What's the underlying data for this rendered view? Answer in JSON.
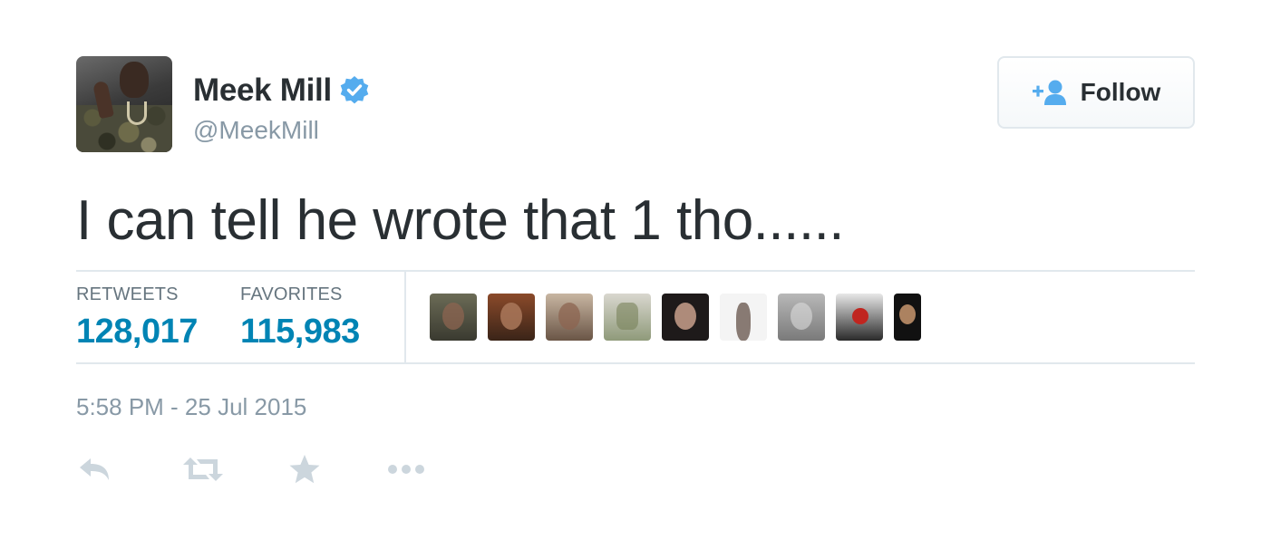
{
  "user": {
    "display_name": "Meek Mill",
    "handle": "@MeekMill",
    "verified": true,
    "verified_icon": "verified-badge-icon"
  },
  "follow_button": {
    "label": "Follow",
    "icon": "add-user-icon"
  },
  "tweet": {
    "text": "I can tell he wrote that 1 tho......",
    "timestamp": "5:58 PM - 25 Jul 2015"
  },
  "stats": {
    "retweets_label": "RETWEETS",
    "retweets_value": "128,017",
    "favorites_label": "FAVORITES",
    "favorites_value": "115,983"
  },
  "favoriters": [
    "face-1",
    "face-2",
    "face-3",
    "face-4",
    "face-5",
    "face-6",
    "face-7",
    "face-8",
    "face-9"
  ],
  "actions": {
    "reply_icon": "reply-icon",
    "retweet_icon": "retweet-icon",
    "favorite_icon": "star-icon",
    "more_icon": "more-icon"
  },
  "colors": {
    "accent": "#0084b4",
    "verified": "#55acee",
    "muted": "#8899a6",
    "text": "#292f33",
    "action_icon": "#ccd6dd"
  }
}
